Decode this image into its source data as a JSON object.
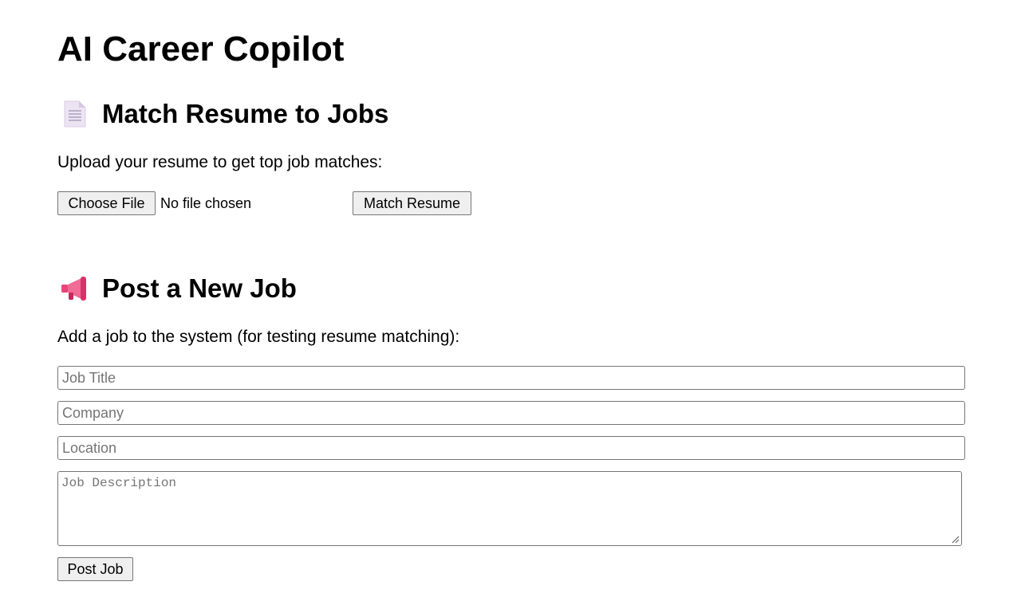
{
  "app": {
    "title": "AI Career Copilot"
  },
  "match_section": {
    "icon": "page-facing-up-icon",
    "heading": "Match Resume to Jobs",
    "instruction": "Upload your resume to get top job matches:",
    "file_input": {
      "button_label": "Choose File",
      "status": "No file chosen"
    },
    "match_button_label": "Match Resume"
  },
  "post_section": {
    "icon": "megaphone-icon",
    "heading": "Post a New Job",
    "instruction": "Add a job to the system (for testing resume matching):",
    "fields": {
      "job_title_placeholder": "Job Title",
      "company_placeholder": "Company",
      "location_placeholder": "Location",
      "description_placeholder": "Job Description"
    },
    "post_button_label": "Post Job"
  },
  "colors": {
    "text": "#000000",
    "button_bg": "#efefef",
    "border": "#767676",
    "placeholder": "#757575",
    "megaphone": "#e8457a"
  }
}
